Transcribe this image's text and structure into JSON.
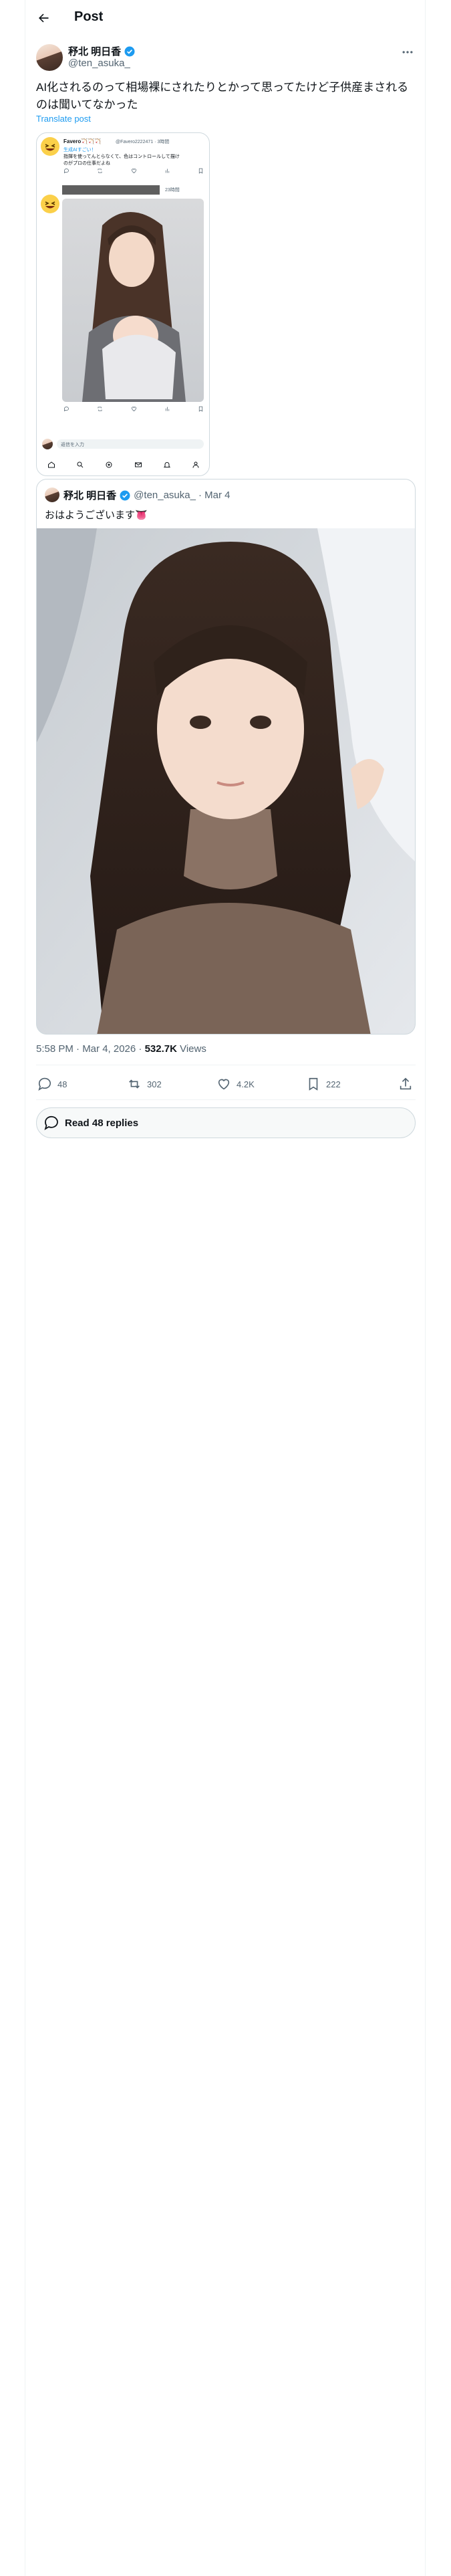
{
  "header": {
    "title": "Post"
  },
  "author": {
    "name": "𥝱北 明日香",
    "handle": "@ten_asuka_"
  },
  "tweet": {
    "text": "AI化されるのって相場裸にされたりとかって思ってたけど子供産まされるのは聞いてなかった",
    "translate": "Translate post"
  },
  "embedded": {
    "name": "Favero🏹🏹🏹",
    "handle": "@Favero2222471 · 3時間",
    "line1": "生成AIすごい！",
    "line2": "指揮を使ってんとらなくて、色はコントロールして描け",
    "line3": "のがプロの仕事だよね",
    "compose_placeholder": "返信を入力",
    "badge": "23時間"
  },
  "quote": {
    "name": "𥝱北 明日香",
    "handle": "@ten_asuka_",
    "date": "· Mar 4",
    "text": "おはようございます👅"
  },
  "meta": {
    "time": "5:58 PM · Mar 4, 2026 · ",
    "views_count": "532.7K",
    "views_label": " Views"
  },
  "actions": {
    "replies": "48",
    "reposts": "302",
    "likes": "4.2K",
    "bookmarks": "222"
  },
  "read_replies": "Read 48 replies",
  "colors": {
    "accent": "#1d9bf0",
    "text": "#0f1419",
    "muted": "#536471",
    "border": "#cfd9de"
  }
}
